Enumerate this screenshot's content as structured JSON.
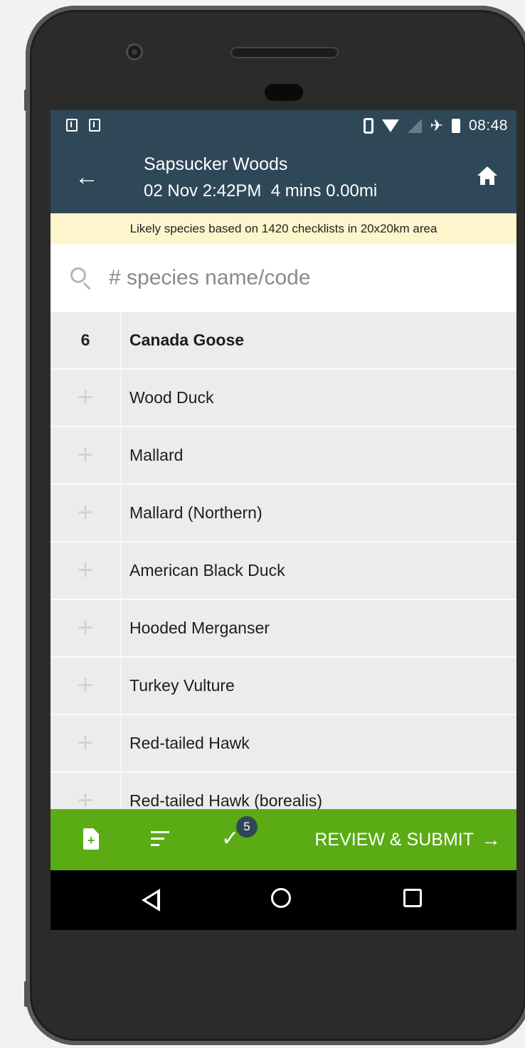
{
  "status_bar": {
    "time": "08:48",
    "icons": [
      "download-icon",
      "download-icon",
      "vibrate-icon",
      "wifi-icon",
      "no-signal-icon",
      "airplane-icon",
      "battery-icon"
    ]
  },
  "app_bar": {
    "title": "Sapsucker Woods",
    "subtitle": "02 Nov 2:42PM  4 mins 0.00mi",
    "back_icon": "back-arrow-icon",
    "home_icon": "home-icon"
  },
  "banner": {
    "text": "Likely species based on 1420 checklists in 20x20km area"
  },
  "search": {
    "placeholder": "# species name/code",
    "value": ""
  },
  "species": [
    {
      "count": "6",
      "name": "Canada Goose",
      "selected": true
    },
    {
      "count": "+",
      "name": "Wood Duck",
      "selected": false
    },
    {
      "count": "+",
      "name": "Mallard",
      "selected": false
    },
    {
      "count": "+",
      "name": "Mallard (Northern)",
      "selected": false
    },
    {
      "count": "+",
      "name": "American Black Duck",
      "selected": false
    },
    {
      "count": "+",
      "name": "Hooded Merganser",
      "selected": false
    },
    {
      "count": "+",
      "name": "Turkey Vulture",
      "selected": false
    },
    {
      "count": "+",
      "name": "Red-tailed Hawk",
      "selected": false
    },
    {
      "count": "+",
      "name": "Red-tailed Hawk (borealis)",
      "selected": false
    }
  ],
  "action_bar": {
    "badge_count": "5",
    "submit_label": "REVIEW & SUBMIT",
    "submit_arrow": "→"
  },
  "colors": {
    "app_bar": "#2f4858",
    "action_bar": "#5aab14",
    "banner": "#fdf6cc"
  }
}
